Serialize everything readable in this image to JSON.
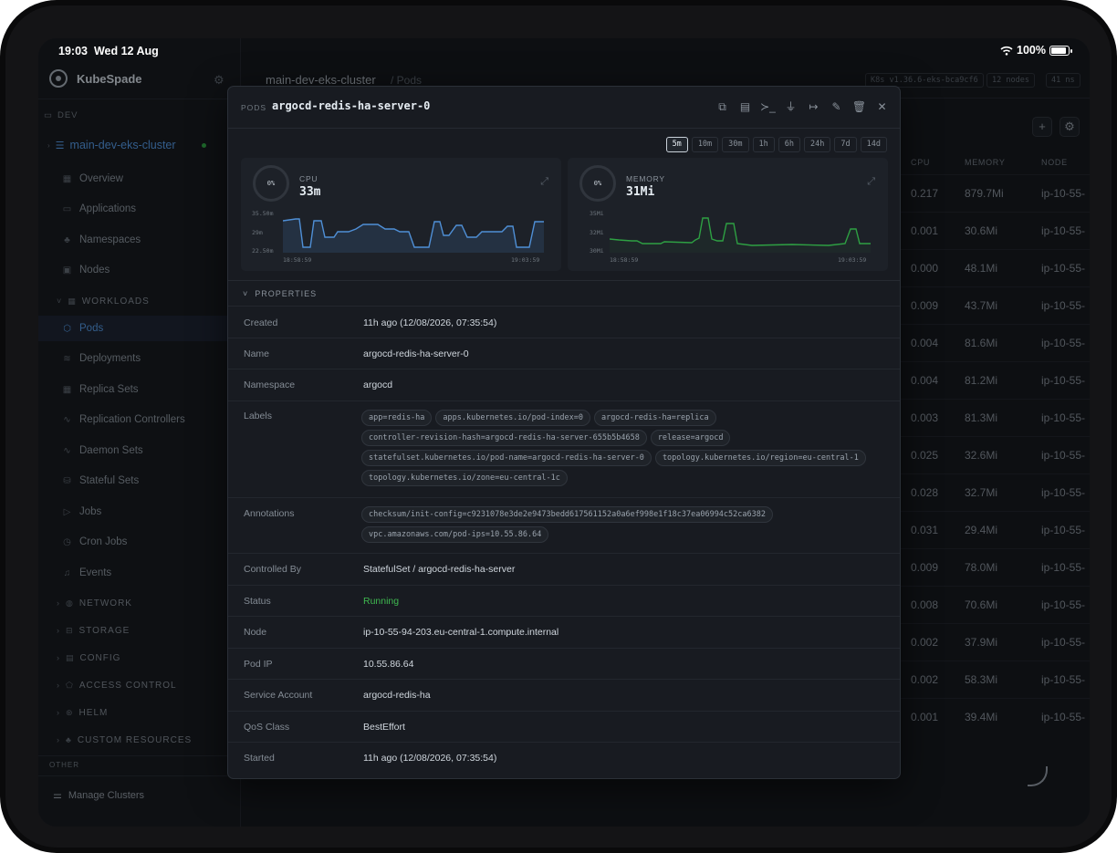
{
  "status_bar": {
    "time": "19:03",
    "date": "Wed 12 Aug",
    "battery": "100%"
  },
  "sidebar": {
    "app_name": "KubeSpade",
    "context_label": "DEV",
    "cluster": "main-dev-eks-cluster",
    "items_top": [
      "Overview",
      "Applications",
      "Namespaces",
      "Nodes"
    ],
    "workloads_label": "WORKLOADS",
    "workloads": [
      "Pods",
      "Deployments",
      "Replica Sets",
      "Replication Controllers",
      "Daemon Sets",
      "Stateful Sets",
      "Jobs",
      "Cron Jobs",
      "Events"
    ],
    "groups": [
      "NETWORK",
      "STORAGE",
      "CONFIG",
      "ACCESS CONTROL",
      "HELM",
      "CUSTOM RESOURCES"
    ],
    "other_label": "OTHER",
    "manage": "Manage Clusters"
  },
  "header": {
    "cluster": "main-dev-eks-cluster",
    "section": "/ Pods",
    "tags": [
      "K8s v1.36.6-eks-bca9cf6",
      "12 nodes",
      "41 ns"
    ]
  },
  "table": {
    "columns": [
      "CPU",
      "MEMORY",
      "NODE"
    ],
    "rows": [
      [
        "0.217",
        "879.7Mi",
        "ip-10-55-"
      ],
      [
        "0.001",
        "30.6Mi",
        "ip-10-55-"
      ],
      [
        "0.000",
        "48.1Mi",
        "ip-10-55-"
      ],
      [
        "0.009",
        "43.7Mi",
        "ip-10-55-"
      ],
      [
        "0.004",
        "81.6Mi",
        "ip-10-55-"
      ],
      [
        "0.004",
        "81.2Mi",
        "ip-10-55-"
      ],
      [
        "0.003",
        "81.3Mi",
        "ip-10-55-"
      ],
      [
        "0.025",
        "32.6Mi",
        "ip-10-55-"
      ],
      [
        "0.028",
        "32.7Mi",
        "ip-10-55-"
      ],
      [
        "0.031",
        "29.4Mi",
        "ip-10-55-"
      ],
      [
        "0.009",
        "78.0Mi",
        "ip-10-55-"
      ],
      [
        "0.008",
        "70.6Mi",
        "ip-10-55-"
      ],
      [
        "0.002",
        "37.9Mi",
        "ip-10-55-"
      ],
      [
        "0.002",
        "58.3Mi",
        "ip-10-55-"
      ],
      [
        "0.001",
        "39.4Mi",
        "ip-10-55-"
      ]
    ]
  },
  "modal": {
    "kind": "PODS",
    "title": "argocd-redis-ha-server-0",
    "ranges": [
      "5m",
      "10m",
      "30m",
      "1h",
      "6h",
      "24h",
      "7d",
      "14d"
    ],
    "selected_range": "5m",
    "cpu": {
      "gauge": "0%",
      "label": "CPU",
      "value": "33m",
      "y_ticks": [
        "35.50m",
        "29m",
        "22.50m"
      ],
      "x_start": "18:58:59",
      "x_end": "19:03:59",
      "color": "#4f8fd6"
    },
    "memory": {
      "gauge": "0%",
      "label": "MEMORY",
      "value": "31Mi",
      "y_ticks": [
        "35Mi",
        "32Mi",
        "30Mi"
      ],
      "x_start": "18:58:59",
      "x_end": "19:03:59",
      "color": "#2ea043"
    },
    "properties_label": "PROPERTIES",
    "props": {
      "created_k": "Created",
      "created_v": "11h ago  (12/08/2026, 07:35:54)",
      "name_k": "Name",
      "name_v": "argocd-redis-ha-server-0",
      "namespace_k": "Namespace",
      "namespace_v": "argocd",
      "labels_k": "Labels",
      "annotations_k": "Annotations",
      "controlled_k": "Controlled By",
      "controlled_v": "StatefulSet / argocd-redis-ha-server",
      "status_k": "Status",
      "status_v": "Running",
      "node_k": "Node",
      "node_v": "ip-10-55-94-203.eu-central-1.compute.internal",
      "podip_k": "Pod IP",
      "podip_v": "10.55.86.64",
      "sa_k": "Service Account",
      "sa_v": "argocd-redis-ha",
      "qos_k": "QoS Class",
      "qos_v": "BestEffort",
      "started_k": "Started",
      "started_v": "11h ago  (12/08/2026, 07:35:54)"
    },
    "labels": [
      "app=redis-ha",
      "apps.kubernetes.io/pod-index=0",
      "argocd-redis-ha=replica",
      "controller-revision-hash=argocd-redis-ha-server-655b5b4658",
      "release=argocd",
      "statefulset.kubernetes.io/pod-name=argocd-redis-ha-server-0",
      "topology.kubernetes.io/region=eu-central-1",
      "topology.kubernetes.io/zone=eu-central-1c"
    ],
    "annotations": [
      "checksum/init-config=c9231078e3de2e9473bedd617561152a0a6ef998e1f18c37ea06994c52ca6382",
      "vpc.amazonaws.com/pod-ips=10.55.86.64"
    ]
  }
}
